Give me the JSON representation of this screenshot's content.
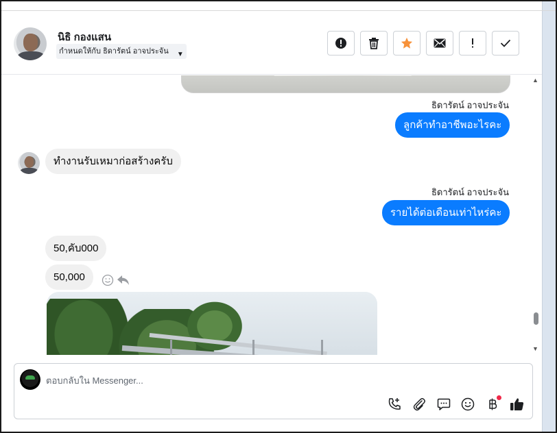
{
  "header": {
    "contact_name": "นิธิ กองแสน",
    "assigned_to": "กำหนดให้กับ ธิดารัตน์ อาจประจัน",
    "actions": [
      "spam",
      "delete",
      "star",
      "mark-unread",
      "important",
      "done"
    ]
  },
  "messages": [
    {
      "type": "image",
      "from": "page"
    },
    {
      "type": "text",
      "from": "page",
      "sender": "ธิดารัตน์ อาจประจัน",
      "text": "ลูกค้าทำอาชีพอะไรคะ"
    },
    {
      "type": "text",
      "from": "customer",
      "text": "ทำงานรับเหมาก่อสร้างครับ"
    },
    {
      "type": "text",
      "from": "page",
      "sender": "ธิดารัตน์ อาจประจัน",
      "text": "รายได้ต่อเดือนเท่าไหร่คะ"
    },
    {
      "type": "text",
      "from": "customer",
      "text": "50,คับ000"
    },
    {
      "type": "text",
      "from": "customer",
      "text": "50,000"
    },
    {
      "type": "image",
      "from": "customer"
    }
  ],
  "composer": {
    "placeholder": "ตอบกลับใน Messenger..."
  },
  "colors": {
    "outgoing_bubble": "#0a7cff",
    "incoming_bubble": "#f0f0f0",
    "star": "#f7923a",
    "badge": "#f02849"
  }
}
